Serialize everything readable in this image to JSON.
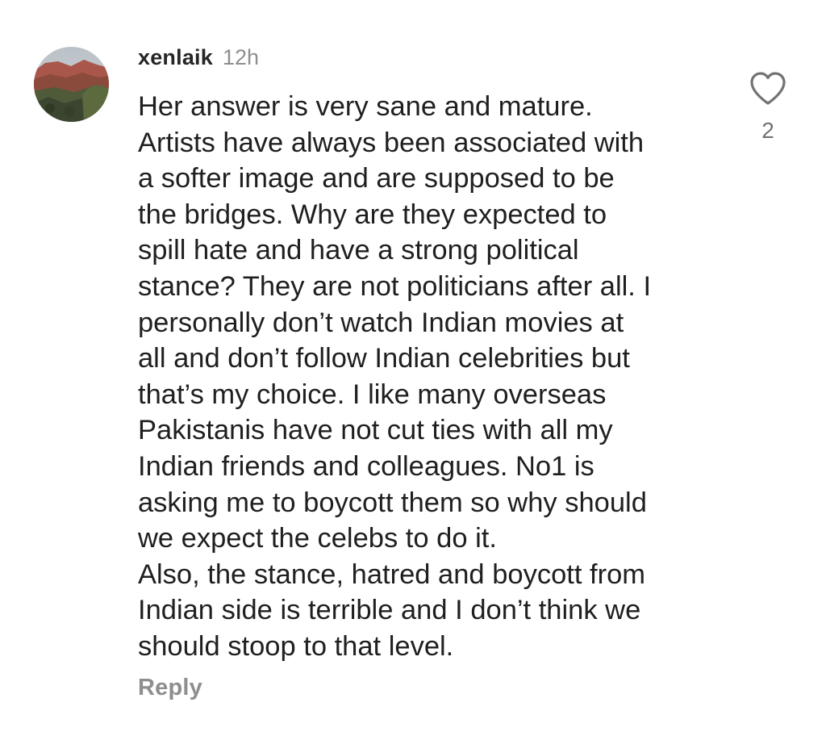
{
  "comment": {
    "username": "xenlaik",
    "timestamp": "12h",
    "body": "Her answer is very sane and mature.\nArtists have always been associated with\na softer image and are supposed to be\nthe bridges. Why are they expected to\nspill hate and have a strong political\nstance? They are not politicians after all. I\npersonally don’t watch Indian movies at\nall and don’t follow Indian celebrities but\nthat’s my choice. I like many overseas\nPakistanis have not cut ties with all my\nIndian friends and colleagues. No1 is\nasking me to boycott them so why should\nwe expect the celebs to do it.\nAlso, the stance, hatred and boycott from\nIndian side is terrible and I don’t think we\nshould stoop to that level.",
    "reply_label": "Reply",
    "like_count": "2",
    "like_icon": "heart-outline-icon"
  },
  "colors": {
    "username": "#262626",
    "secondary_text": "#8e8e8e",
    "body_text": "#1f1f1f",
    "like_icon": "#737373"
  }
}
